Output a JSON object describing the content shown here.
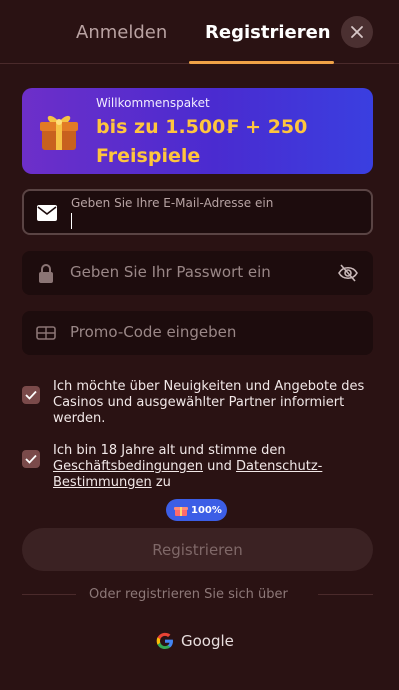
{
  "tabs": {
    "login": "Anmelden",
    "register": "Registrieren"
  },
  "banner": {
    "small": "Willkommenspaket",
    "line1": "bis zu 1.500₣ + 250",
    "line2": "Freispiele"
  },
  "form": {
    "email_label": "Geben Sie Ihre E-Mail-Adresse ein",
    "password_placeholder": "Geben Sie Ihr Passwort ein",
    "promo_placeholder": "Promo-Code eingeben"
  },
  "consent": {
    "news": "Ich möchte über Neuigkeiten und Angebote des Casinos und ausgewählter Partner informiert werden.",
    "age_prefix": "Ich bin 18 Jahre alt und stimme den",
    "terms_link": "Geschäftsbedingungen",
    "and": "und",
    "privacy_link": "Datenschutz-Bestimmungen",
    "age_suffix": "zu"
  },
  "badge": {
    "label": "100%"
  },
  "submit": {
    "label": "Registrieren"
  },
  "divider": {
    "label": "Oder registrieren Sie sich über"
  },
  "social": {
    "google": "Google"
  },
  "colors": {
    "background": "#2a1213",
    "accent": "#f0a247",
    "banner_gold": "#ffc53d",
    "badge_blue": "#3c5ee6"
  },
  "icons": [
    "close-icon",
    "gift-icon",
    "envelope-icon",
    "lock-icon",
    "eye-off-icon",
    "promo-ticket-icon",
    "check-icon",
    "google-icon"
  ]
}
